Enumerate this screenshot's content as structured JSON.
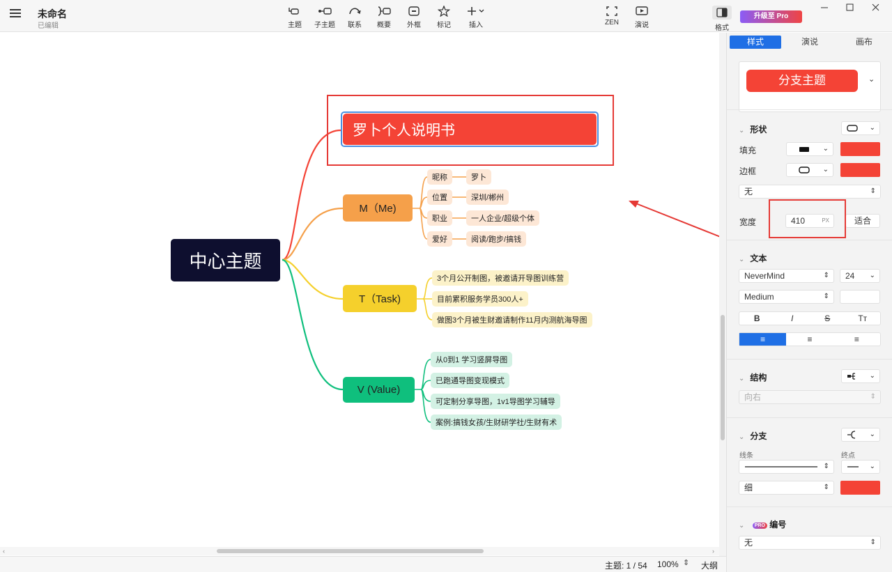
{
  "app": {
    "title": "未命名",
    "subtitle": "已编辑"
  },
  "toolbar": {
    "topic": "主题",
    "subtopic": "子主题",
    "relation": "联系",
    "summary": "概要",
    "boundary": "外框",
    "marker": "标记",
    "insert": "插入",
    "zen": "ZEN",
    "present": "演说",
    "format": "格式",
    "upgrade": "升级至 Pro"
  },
  "mindmap": {
    "root": "中心主题",
    "selected_topic": "罗卜个人说明书",
    "branches": [
      {
        "label": "M（Me)",
        "color": "#f5a04a",
        "pairs": [
          {
            "key": "昵称",
            "value": "罗卜"
          },
          {
            "key": "位置",
            "value": "深圳/郴州"
          },
          {
            "key": "职业",
            "value": "一人企业/超级个体"
          },
          {
            "key": "爱好",
            "value": "阅读/跑步/搞钱"
          }
        ]
      },
      {
        "label": "T（Task)",
        "color": "#f5d02c",
        "items": [
          "3个月公开制图，被邀请开导图训练营",
          "目前累积服务学员300人+",
          "做图3个月被生财邀请制作11月内测航海导图"
        ]
      },
      {
        "label": "V (Value)",
        "color": "#0fbf7d",
        "items": [
          "从0到1 学习竖屏导图",
          "已跑通导图变现模式",
          "可定制分享导图，1v1导图学习辅导",
          "案例:搞钱女孩/生财研学社/生财有术"
        ]
      }
    ],
    "colors": {
      "root_bg": "#0e0f2f",
      "selected_bg": "#f44336",
      "annotation_red": "#e53935",
      "m_sub_bg": "#fde7d6",
      "t_sub_bg": "#fcf2c9",
      "v_sub_bg": "#d3f1e4"
    }
  },
  "status": {
    "topic_count": "主题: 1 / 54",
    "zoom": "100%",
    "outline": "大纲"
  },
  "panel": {
    "tabs": [
      "样式",
      "演说",
      "画布"
    ],
    "preview": "分支主题",
    "shape": {
      "title": "形状",
      "fill_label": "填充",
      "border_label": "边框",
      "shadow_value": "无",
      "width_label": "宽度",
      "width_value": "410",
      "width_unit": "PX",
      "fit_label": "适合"
    },
    "text": {
      "title": "文本",
      "font": "NeverMind",
      "size": "24",
      "weight": "Medium",
      "styles": [
        "B",
        "I",
        "S",
        "Tт"
      ]
    },
    "structure": {
      "title": "结构",
      "direction": "向右"
    },
    "branch": {
      "title": "分支",
      "line_label": "线条",
      "end_label": "终点",
      "thickness": "细"
    },
    "numbering": {
      "pro_badge": "PRO",
      "title": "编号",
      "value": "无"
    }
  }
}
